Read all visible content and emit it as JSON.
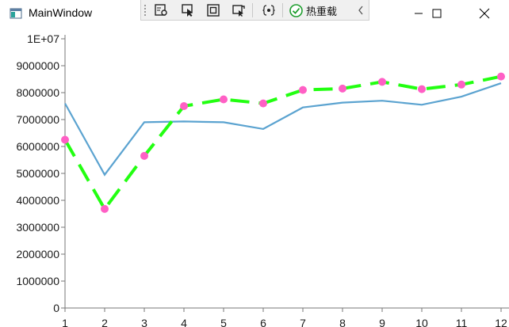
{
  "window": {
    "title": "MainWindow",
    "icons": {
      "app": "app-window-icon",
      "minimize": "minimize-icon",
      "maximize": "maximize-icon",
      "close": "close-icon"
    }
  },
  "devbar": {
    "icons": [
      "live-visual-tree-icon",
      "select-element-icon",
      "display-layout-adorners-icon",
      "track-focus-icon",
      "binding-failures-icon",
      "hot-reload-check-icon",
      "collapse-chevron-icon"
    ],
    "hot_reload_label": "热重载"
  },
  "chart_data": {
    "type": "line",
    "x": [
      1,
      2,
      3,
      4,
      5,
      6,
      7,
      8,
      9,
      10,
      11,
      12
    ],
    "y_tick_labels": [
      "0",
      "1000000",
      "2000000",
      "3000000",
      "4000000",
      "5000000",
      "6000000",
      "7000000",
      "8000000",
      "9000000",
      "1E+07"
    ],
    "x_tick_labels": [
      "1",
      "2",
      "3",
      "4",
      "5",
      "6",
      "7",
      "8",
      "9",
      "10",
      "11",
      "12"
    ],
    "ylim": [
      0,
      10000000
    ],
    "xlim": [
      1,
      12
    ],
    "grid": false,
    "series": [
      {
        "style": "solid",
        "color": "#5ba3d0",
        "values": [
          7600000,
          4950000,
          6900000,
          6930000,
          6900000,
          6650000,
          7450000,
          7630000,
          7700000,
          7550000,
          7850000,
          8350000
        ]
      },
      {
        "style": "dashed",
        "color": "#22ff11",
        "marker_color": "#ff5fc5",
        "values": [
          6250000,
          3680000,
          5650000,
          7500000,
          7750000,
          7600000,
          8100000,
          8150000,
          8400000,
          8130000,
          8300000,
          8600000
        ]
      }
    ]
  }
}
